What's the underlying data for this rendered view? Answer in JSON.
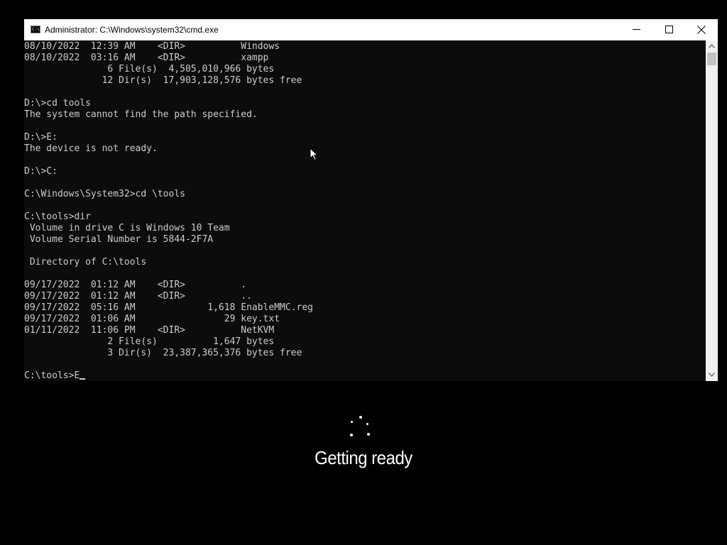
{
  "window": {
    "title": "Administrator: C:\\Windows\\system32\\cmd.exe",
    "icon": "cmd-app-icon",
    "icon_text": "C:\\"
  },
  "console": {
    "lines": [
      "08/10/2022  12:39 AM    <DIR>          Windows",
      "08/10/2022  03:16 AM    <DIR>          xampp",
      "               6 File(s)  4,505,010,966 bytes",
      "              12 Dir(s)  17,903,128,576 bytes free",
      "",
      "D:\\>cd tools",
      "The system cannot find the path specified.",
      "",
      "D:\\>E:",
      "The device is not ready.",
      "",
      "D:\\>C:",
      "",
      "C:\\Windows\\System32>cd \\tools",
      "",
      "C:\\tools>dir",
      " Volume in drive C is Windows 10 Team",
      " Volume Serial Number is 5844-2F7A",
      "",
      " Directory of C:\\tools",
      "",
      "09/17/2022  01:12 AM    <DIR>          .",
      "09/17/2022  01:12 AM    <DIR>          ..",
      "09/17/2022  05:16 AM             1,618 EnableMMC.reg",
      "09/17/2022  01:06 AM                29 key.txt",
      "01/11/2022  11:06 PM    <DIR>          NetKVM",
      "               2 File(s)          1,647 bytes",
      "               3 Dir(s)  23,387,365,376 bytes free",
      ""
    ],
    "prompt": "C:\\tools>",
    "input": "E",
    "foreground": "#cccccc",
    "background": "#0c0c0c"
  },
  "overlay": {
    "status": "Getting ready",
    "spinner_icon": "loading-spinner-icon"
  },
  "colors": {
    "titlebar": "#ffffff",
    "desktop": "#000000",
    "scrollbar": "#f0f0f0"
  }
}
